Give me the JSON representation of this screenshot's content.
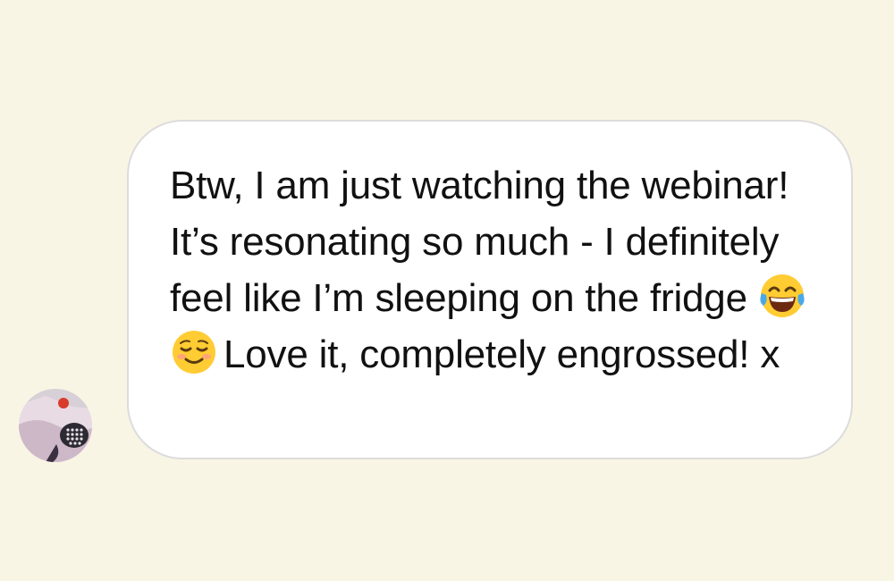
{
  "conversation": {
    "sender_avatar_icon": "user-avatar-photo",
    "message": {
      "text_parts": [
        "Btw, I am just watching the webinar! It’s resonating so much - I definitely feel like I’m sleeping on the fridge ",
        "Love it, completely engrossed! x"
      ],
      "emojis": [
        "face-with-tears-of-joy-icon",
        "smiling-face-icon"
      ]
    }
  },
  "colors": {
    "background": "#f9f5e5",
    "bubble": "#ffffff",
    "bubble_border": "#dddcdc",
    "text": "#111111"
  }
}
